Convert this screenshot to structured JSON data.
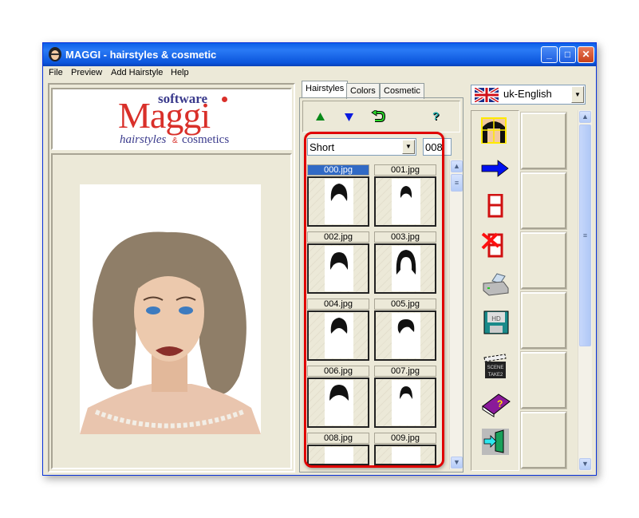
{
  "window": {
    "title": "MAGGI - hairstyles & cosmetic",
    "controls": [
      "minimize",
      "maximize",
      "close"
    ]
  },
  "menu": [
    "File",
    "Preview",
    "Add Hairstyle",
    "Help"
  ],
  "logo": {
    "top": "software",
    "main": "Maggi",
    "sub": "hairstyles",
    "amp": "&",
    "sub2": "cosmetics"
  },
  "tabs": [
    {
      "label": "Hairstyles",
      "active": true
    },
    {
      "label": "Colors"
    },
    {
      "label": "Cosmetic"
    }
  ],
  "toolbar": {
    "icons": [
      "arrow-up-icon",
      "arrow-down-icon",
      "undo-icon",
      "help-icon"
    ],
    "help_label": "?"
  },
  "category": {
    "value": "Short"
  },
  "number_field": {
    "value": "008"
  },
  "thumbnails": [
    {
      "label": "000.jpg",
      "selected": true
    },
    {
      "label": "001.jpg"
    },
    {
      "label": "002.jpg"
    },
    {
      "label": "003.jpg"
    },
    {
      "label": "004.jpg"
    },
    {
      "label": "005.jpg"
    },
    {
      "label": "006.jpg"
    },
    {
      "label": "007.jpg"
    },
    {
      "label": "008.jpg"
    },
    {
      "label": "009.jpg"
    }
  ],
  "language": {
    "value": "uk-English"
  },
  "side_tools": [
    "face-grid-icon",
    "arrow-right-icon",
    "film-strip-icon",
    "delete-film-icon",
    "print-icon",
    "save-disk-icon",
    "clapperboard-icon",
    "help-book-icon",
    "exit-door-icon"
  ],
  "clapper_text": [
    "SCENE",
    "TAKE2"
  ],
  "disk_text": "HD",
  "colors": {
    "highlight": "#e00000",
    "title_bar": "#0b55dc",
    "logo_red": "#d9302a",
    "logo_blue": "#3a3a8c"
  }
}
